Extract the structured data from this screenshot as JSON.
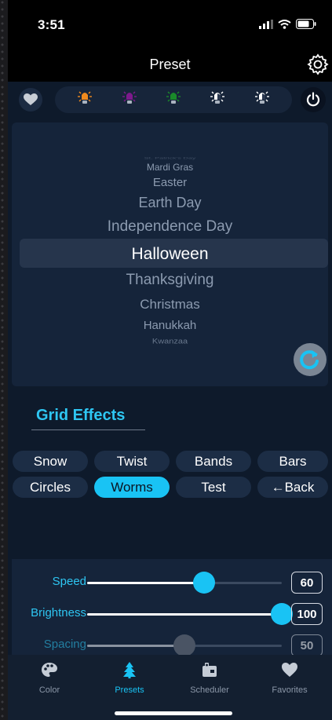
{
  "status": {
    "time": "3:51"
  },
  "header": {
    "title": "Preset"
  },
  "toolbar": {
    "bulbs": [
      {
        "name": "orange-bulb-icon",
        "color": "#f08a1e"
      },
      {
        "name": "purple-bulb-icon",
        "color": "#7d1a8c"
      },
      {
        "name": "green-bulb-icon",
        "color": "#1a8a2a"
      },
      {
        "name": "white-bulb-icon",
        "color": "#ffffff"
      },
      {
        "name": "white-bulb-icon",
        "color": "#ffffff"
      }
    ]
  },
  "picker": {
    "items": [
      "St. Patrick's Day",
      "Mardi Gras",
      "Easter",
      "Earth Day",
      "Independence Day",
      "Halloween",
      "Thanksgiving",
      "Christmas",
      "Hanukkah",
      "Kwanzaa"
    ],
    "selected": "Halloween"
  },
  "grid_effects": {
    "title": "Grid Effects",
    "row1": [
      "Snow",
      "Twist",
      "Bands",
      "Bars"
    ],
    "row2": [
      "Circles",
      "Worms",
      "Test",
      "←Back"
    ],
    "active": "Worms"
  },
  "sliders": [
    {
      "label": "Speed",
      "value": "60",
      "fraction": 0.6
    },
    {
      "label": "Brightness",
      "value": "100",
      "fraction": 1.0
    },
    {
      "label": "Spacing",
      "value": "50",
      "fraction": 0.5
    }
  ],
  "tabs": [
    {
      "label": "Color",
      "icon": "palette-icon"
    },
    {
      "label": "Presets",
      "icon": "tree-icon",
      "active": true
    },
    {
      "label": "Scheduler",
      "icon": "scheduler-icon"
    },
    {
      "label": "Favorites",
      "icon": "heart-icon"
    }
  ],
  "colors": {
    "accent": "#19c3f4",
    "panel": "#0e1a2b"
  }
}
